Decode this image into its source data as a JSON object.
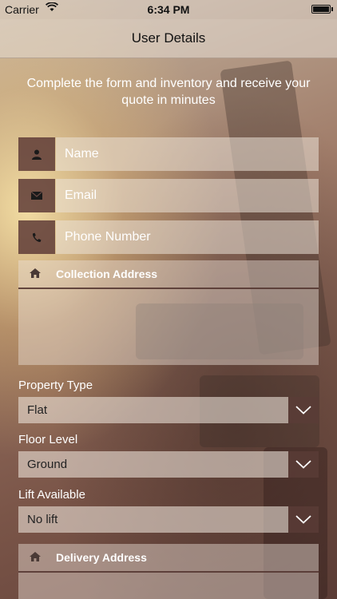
{
  "status_bar": {
    "carrier": "Carrier",
    "time": "6:34 PM"
  },
  "nav": {
    "title": "User Details"
  },
  "intro": {
    "text": "Complete the form and inventory and receive your quote in minutes"
  },
  "fields": {
    "name": {
      "placeholder": "Name",
      "icon": "person-icon"
    },
    "email": {
      "placeholder": "Email",
      "icon": "envelope-icon"
    },
    "phone": {
      "placeholder": "Phone Number",
      "icon": "phone-icon"
    }
  },
  "collection": {
    "label": "Collection Address",
    "icon": "home-icon"
  },
  "property_type": {
    "label": "Property Type",
    "value": "Flat"
  },
  "floor_level": {
    "label": "Floor Level",
    "value": "Ground"
  },
  "lift": {
    "label": "Lift Available",
    "value": "No lift"
  },
  "delivery": {
    "label": "Delivery Address",
    "icon": "home-icon"
  }
}
